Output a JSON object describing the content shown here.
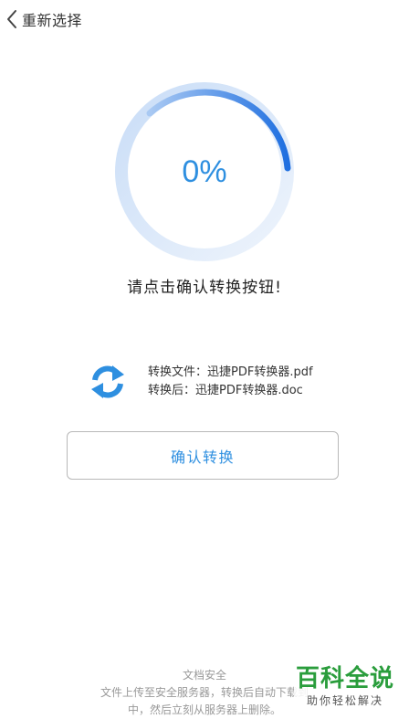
{
  "header": {
    "back_label": "重新选择",
    "back_icon": "chevron-left-icon"
  },
  "progress": {
    "percent_text": "0%",
    "value": 0,
    "accent_color": "#2e8fe0"
  },
  "prompt": "请点击确认转换按钮!",
  "conversion": {
    "icon": "sync-icon",
    "source_line": "转换文件：迅捷PDF转换器.pdf",
    "target_line": "转换后：迅捷PDF转换器.doc"
  },
  "confirm_button": {
    "label": "确认转换"
  },
  "footer": {
    "title": "文档安全",
    "line1": "文件上传至安全服务器，转换后自动下载到",
    "line2": "中，然后立刻从服务器上删除。"
  },
  "watermark": {
    "main": "百科全说",
    "sub": "助你轻松解决"
  }
}
